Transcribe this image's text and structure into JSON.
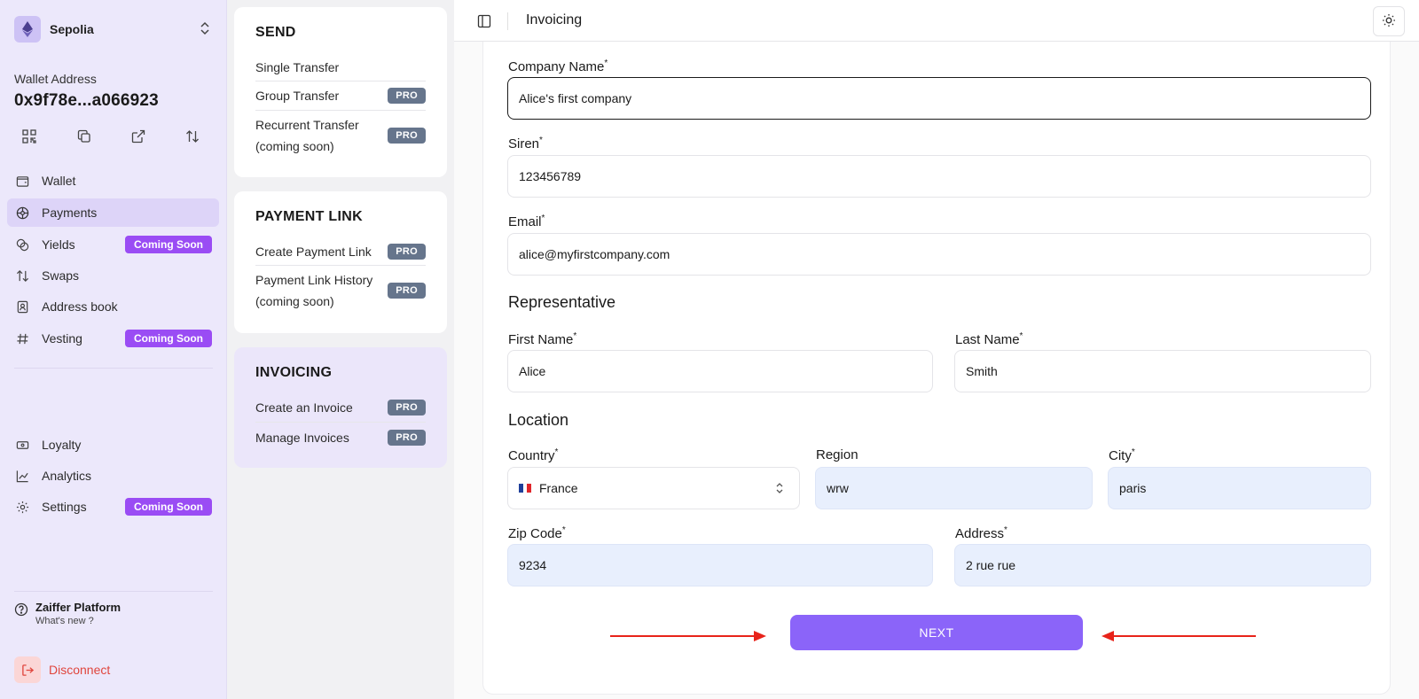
{
  "network": {
    "name": "Sepolia"
  },
  "wallet": {
    "label": "Wallet Address",
    "address": "0x9f78e...a066923"
  },
  "nav": {
    "wallet": "Wallet",
    "payments": "Payments",
    "yields": "Yields",
    "swaps": "Swaps",
    "address_book": "Address book",
    "vesting": "Vesting",
    "loyalty": "Loyalty",
    "analytics": "Analytics",
    "settings": "Settings",
    "coming_soon": "Coming Soon"
  },
  "help": {
    "title": "Zaiffer Platform",
    "subtitle": "What's new ?"
  },
  "disconnect": "Disconnect",
  "menu": {
    "pro": "PRO",
    "send": {
      "title": "SEND",
      "single": "Single Transfer",
      "group": "Group Transfer",
      "recurrent_1": "Recurrent Transfer",
      "recurrent_2": "(coming soon)"
    },
    "payment_link": {
      "title": "PAYMENT LINK",
      "create": "Create Payment Link",
      "history_1": "Payment Link History",
      "history_2": "(coming soon)"
    },
    "invoicing": {
      "title": "INVOICING",
      "create": "Create an Invoice",
      "manage": "Manage Invoices"
    }
  },
  "topbar": {
    "title": "Invoicing"
  },
  "form": {
    "company_name": {
      "label": "Company Name",
      "value": "Alice's first company"
    },
    "siren": {
      "label": "Siren",
      "value": "123456789"
    },
    "email": {
      "label": "Email",
      "value": "alice@myfirstcompany.com"
    },
    "representative": "Representative",
    "first_name": {
      "label": "First Name",
      "value": "Alice"
    },
    "last_name": {
      "label": "Last Name",
      "value": "Smith"
    },
    "location": "Location",
    "country": {
      "label": "Country",
      "value": "France"
    },
    "region": {
      "label": "Region",
      "value": "wrw"
    },
    "city": {
      "label": "City",
      "value": "paris"
    },
    "zip": {
      "label": "Zip Code",
      "value": "9234"
    },
    "address": {
      "label": "Address",
      "value": "2 rue rue"
    },
    "required_mark": "*",
    "next": "NEXT"
  },
  "colors": {
    "accent": "#8b64f9",
    "badge": "#9a4cf4",
    "pro": "#66758c",
    "arrow": "#e8231a"
  }
}
